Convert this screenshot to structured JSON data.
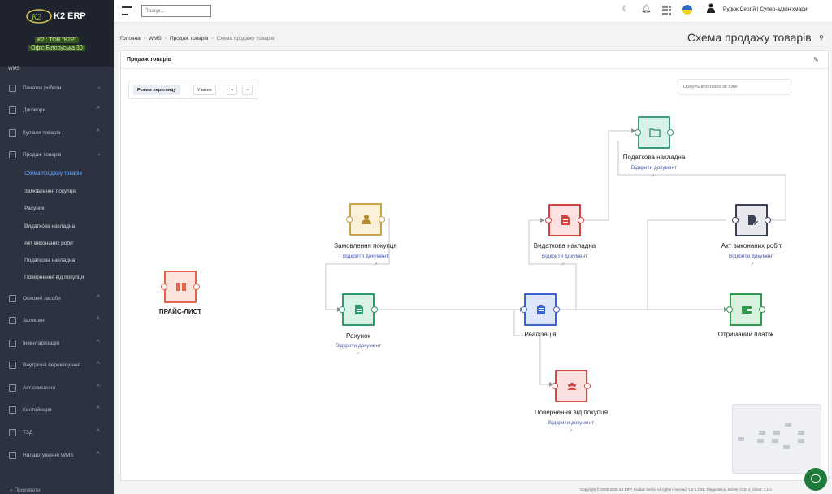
{
  "app": {
    "brand": "K2 ERP",
    "company_line1": "K2 : ТОВ \"К2Р\"",
    "company_line2": "Офіс Білоруська 30"
  },
  "search": {
    "placeholder": "Пошук..."
  },
  "user": {
    "name": "Рудюк Сергій | Супер-адмін хмари"
  },
  "sidebar": {
    "section": "WMS",
    "items": [
      {
        "label": "Початок роботи"
      },
      {
        "label": "Договори"
      },
      {
        "label": "Купівля товарів"
      },
      {
        "label": "Продаж товарів"
      },
      {
        "label": "Основні засоби"
      },
      {
        "label": "Залишки"
      },
      {
        "label": "Інвентаризація"
      },
      {
        "label": "Внутрішні переміщення"
      },
      {
        "label": "Акт списання"
      },
      {
        "label": "Контейнери"
      },
      {
        "label": "ТЗД"
      },
      {
        "label": "Налаштування WMS"
      }
    ],
    "subitems": [
      {
        "label": "Схема продажу товарів",
        "active": true
      },
      {
        "label": "Замовлення покупця"
      },
      {
        "label": "Рахунок"
      },
      {
        "label": "Видаткова накладна"
      },
      {
        "label": "Акт виконаних робіт"
      },
      {
        "label": "Податкова накладна"
      },
      {
        "label": "Повернення від покупця"
      }
    ],
    "collapse": "Приховати"
  },
  "breadcrumb": [
    "Головна",
    "WMS",
    "Продаж товарів",
    "Схема продажу товарів"
  ],
  "page": {
    "title": "Схема продажу товарів"
  },
  "panel": {
    "title": "Продаж товарів"
  },
  "toolbar": {
    "view_mode": "Режим перегляду",
    "fit": "У вікно",
    "zoom_in": "+",
    "zoom_out": "−"
  },
  "node_search": {
    "placeholder": "Оберіть вузол або зв`язок"
  },
  "nodes": {
    "price": {
      "label": "ПРАЙС-ЛИСТ",
      "color": "#e0654a",
      "bg": "#fbe4dc",
      "icon": "price-list-icon"
    },
    "order": {
      "label": "Замовлення покупця",
      "link": "Відкрити документ",
      "color": "#c9a24a",
      "bg": "#fbf0d9",
      "icon": "user-icon"
    },
    "invoice": {
      "label": "Рахунок",
      "link": "Відкрити документ",
      "color": "#2e9a6e",
      "bg": "#d8f2e7",
      "icon": "document-icon"
    },
    "waybill": {
      "label": "Видаткова накладна",
      "link": "Відкрити документ",
      "color": "#d2443f",
      "bg": "#fbe1df",
      "icon": "document-icon"
    },
    "taxinv": {
      "label": "Податкова накладна",
      "link": "Відкрити документ",
      "color": "#3a9a7a",
      "bg": "#d8f2ea",
      "icon": "folder-icon"
    },
    "act": {
      "label": "Акт виконаних робіт",
      "link": "Відкрити документ",
      "color": "#3c4256",
      "bg": "#e6e8ee",
      "icon": "edit-document-icon"
    },
    "sale": {
      "label": "Реалізація",
      "color": "#3a64cf",
      "bg": "#dde6fb",
      "icon": "clipboard-icon"
    },
    "payment": {
      "label": "Отриманий платіж",
      "color": "#2f9a4e",
      "bg": "#d9f2df",
      "icon": "wallet-icon"
    },
    "return": {
      "label": "Повернення від покупця",
      "link": "Відкрити документ",
      "color": "#d44a4a",
      "bg": "#fbe0e0",
      "icon": "group-icon"
    }
  },
  "footer": {
    "text": "Copyright © 2000-2026 K2 ERP, Rudiuk Serhii. All rights reserved. v:2.5.1.85, Diagnostics, Server: 0.10 s, Client: 1.1 s"
  }
}
